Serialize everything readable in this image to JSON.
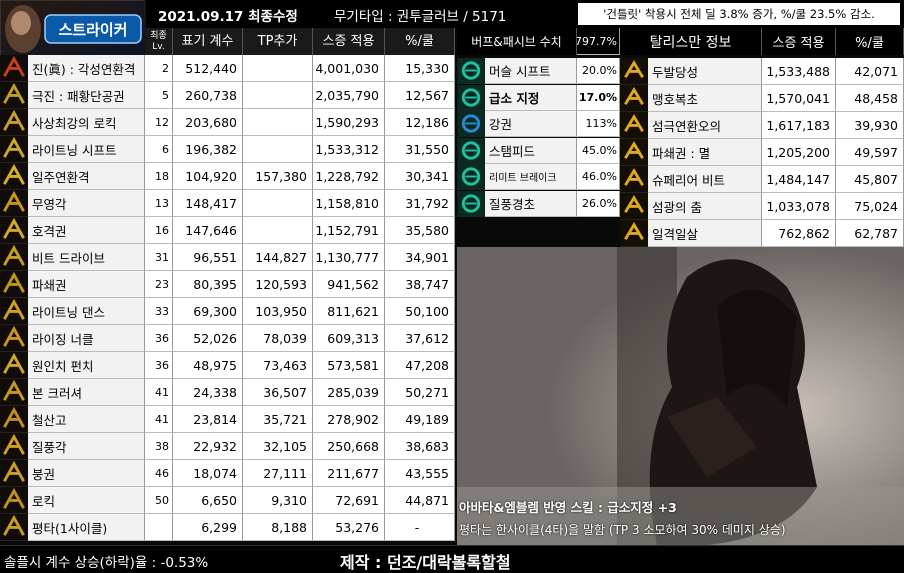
{
  "header": {
    "banner": "스트라이커",
    "date": "2021.09.17 최종수정",
    "weapon": "무기타입 : 권투글러브 / 5171",
    "notice": "'건틀릿' 착용시 전체 딜 3.8% 증가, %/쿨 23.5% 감소."
  },
  "skills_table": {
    "columns": {
      "lv": "최종\nLv.",
      "coef": "표기 계수",
      "tp": "TP추가",
      "final": "스증 적용",
      "percool": "%/쿨"
    },
    "rows": [
      {
        "name": "진(眞) : 각성연환격",
        "lv": "2",
        "coef": "512,440",
        "tp": "",
        "final": "4,001,030",
        "percool": "15,330"
      },
      {
        "name": "극진 : 패황단공권",
        "lv": "5",
        "coef": "260,738",
        "tp": "",
        "final": "2,035,790",
        "percool": "12,567"
      },
      {
        "name": "사상최강의 로킥",
        "lv": "12",
        "coef": "203,680",
        "tp": "",
        "final": "1,590,293",
        "percool": "12,186"
      },
      {
        "name": "라이트닝 시프트",
        "lv": "6",
        "coef": "196,382",
        "tp": "",
        "final": "1,533,312",
        "percool": "31,550"
      },
      {
        "name": "일주연환격",
        "lv": "18",
        "coef": "104,920",
        "tp": "157,380",
        "final": "1,228,792",
        "percool": "30,341"
      },
      {
        "name": "무영각",
        "lv": "13",
        "coef": "148,417",
        "tp": "",
        "final": "1,158,810",
        "percool": "31,792"
      },
      {
        "name": "호격권",
        "lv": "16",
        "coef": "147,646",
        "tp": "",
        "final": "1,152,791",
        "percool": "35,580"
      },
      {
        "name": "비트 드라이브",
        "lv": "31",
        "coef": "96,551",
        "tp": "144,827",
        "final": "1,130,777",
        "percool": "34,901"
      },
      {
        "name": "파쇄권",
        "lv": "23",
        "coef": "80,395",
        "tp": "120,593",
        "final": "941,562",
        "percool": "38,747"
      },
      {
        "name": "라이트닝 댄스",
        "lv": "33",
        "coef": "69,300",
        "tp": "103,950",
        "final": "811,621",
        "percool": "50,100"
      },
      {
        "name": "라이징 너클",
        "lv": "36",
        "coef": "52,026",
        "tp": "78,039",
        "final": "609,313",
        "percool": "37,612"
      },
      {
        "name": "원인치 펀치",
        "lv": "36",
        "coef": "48,975",
        "tp": "73,463",
        "final": "573,581",
        "percool": "47,208"
      },
      {
        "name": "본 크러셔",
        "lv": "41",
        "coef": "24,338",
        "tp": "36,507",
        "final": "285,039",
        "percool": "50,271"
      },
      {
        "name": "철산고",
        "lv": "41",
        "coef": "23,814",
        "tp": "35,721",
        "final": "278,902",
        "percool": "49,189"
      },
      {
        "name": "질풍각",
        "lv": "38",
        "coef": "22,932",
        "tp": "32,105",
        "final": "250,668",
        "percool": "38,683"
      },
      {
        "name": "붕권",
        "lv": "46",
        "coef": "18,074",
        "tp": "27,111",
        "final": "211,677",
        "percool": "43,555"
      },
      {
        "name": "로킥",
        "lv": "50",
        "coef": "6,650",
        "tp": "9,310",
        "final": "72,691",
        "percool": "44,871"
      },
      {
        "name": "평타(1사이클)",
        "lv": "",
        "coef": "6,299",
        "tp": "8,188",
        "final": "53,276",
        "percool": "-"
      }
    ]
  },
  "buff_table": {
    "title": "버프&패시브 수치",
    "total": "797.7%",
    "rows": [
      {
        "name": "머슬 시프트",
        "value": "20.0%",
        "bold": false
      },
      {
        "name": "급소 지정",
        "value": "17.0%",
        "bold": true
      },
      {
        "name": "강권",
        "value": "113%",
        "bold": false
      },
      {
        "name": "스탬피드",
        "value": "45.0%",
        "bold": false
      },
      {
        "name": "리미트 브레이크",
        "value": "46.0%",
        "bold": false
      },
      {
        "name": "질풍경초",
        "value": "26.0%",
        "bold": false
      }
    ]
  },
  "talisman_table": {
    "columns": {
      "name": "탈리스만 정보",
      "final": "스증 적용",
      "percool": "%/쿨"
    },
    "rows": [
      {
        "name": "두발당성",
        "final": "1,533,488",
        "percool": "42,071"
      },
      {
        "name": "맹호복초",
        "final": "1,570,041",
        "percool": "48,458"
      },
      {
        "name": "섬극연환오의",
        "final": "1,617,183",
        "percool": "39,930"
      },
      {
        "name": "파쇄권 : 멸",
        "final": "1,205,200",
        "percool": "49,597"
      },
      {
        "name": "슈페리어 비트",
        "final": "1,484,147",
        "percool": "45,807"
      },
      {
        "name": "섬광의 춤",
        "final": "1,033,078",
        "percool": "75,024"
      },
      {
        "name": "일격일살",
        "final": "762,862",
        "percool": "62,787"
      }
    ]
  },
  "notes": {
    "avatar": "아바타&엠블렘 반영 스킬 : 급소지정 +3",
    "basic": "평타는 한사이클(4타)을 말함 (TP 3 소모하여 30% 데미지 상승)"
  },
  "footer": {
    "solfeel": "솔플시 계수 상승(하락)율 : -0.53%",
    "credit": "제작 : 던조/대락볼록할철"
  },
  "colors": {
    "gold": "#e8b020",
    "teal": "#18b0a0",
    "header_bg": "#000000"
  }
}
